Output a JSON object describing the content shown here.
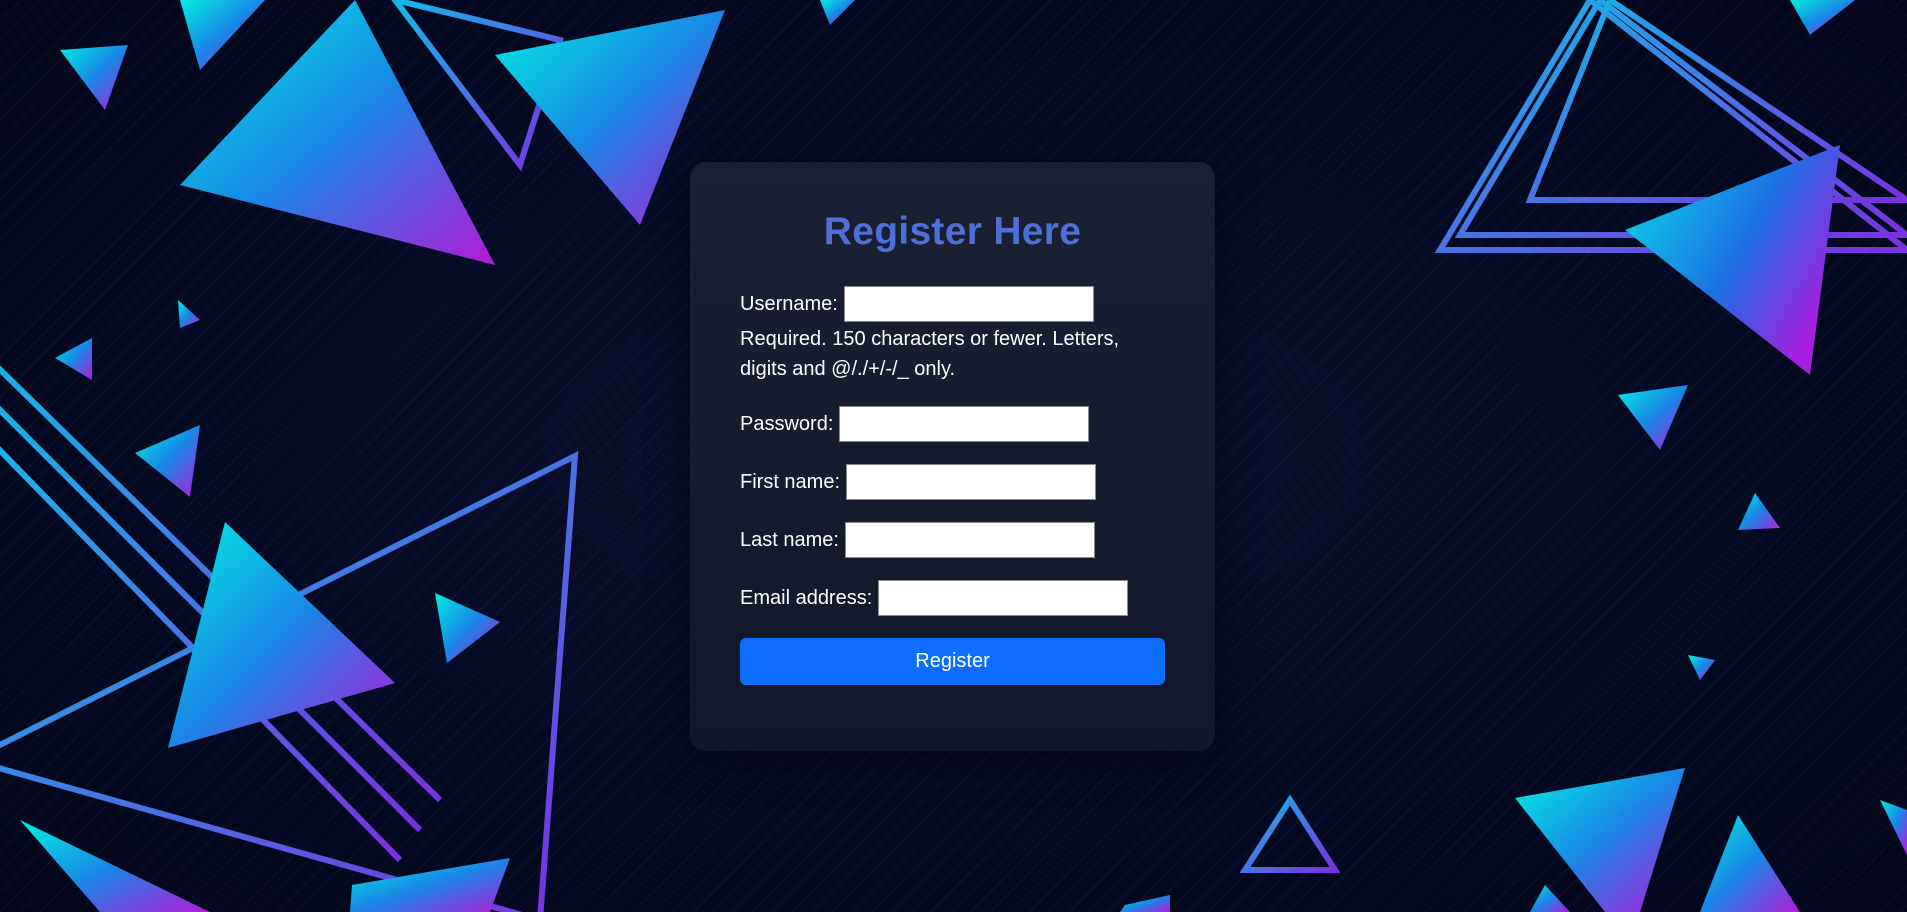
{
  "colors": {
    "background": "#040822",
    "card": "#161d30",
    "title": "#4d6fd6",
    "button": "#0d6efd",
    "triangle_gradient_start": "#00e5e0",
    "triangle_gradient_mid": "#1a7fe0",
    "triangle_gradient_end": "#b21fd6"
  },
  "form": {
    "title": "Register Here",
    "username_label": "Username:",
    "username_value": "",
    "username_help": "Required. 150 characters or fewer. Letters, digits and @/./+/-/_ only.",
    "password_label": "Password:",
    "password_value": "",
    "first_name_label": "First name:",
    "first_name_value": "",
    "last_name_label": "Last name:",
    "last_name_value": "",
    "email_label": "Email address:",
    "email_value": "",
    "submit_label": "Register"
  },
  "background": {
    "decoration": "triangle-pattern"
  }
}
